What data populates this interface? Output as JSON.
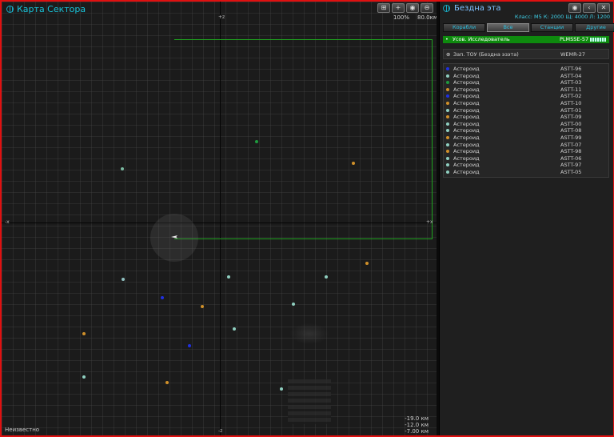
{
  "map": {
    "title": "Карта Сектора",
    "zoom": "100%",
    "range": "80.0км",
    "axis_top": "+z",
    "axis_bottom": "-z",
    "axis_left": "-x",
    "axis_right": "+x",
    "status": "Неизвестно",
    "distances": [
      "-19.0 км",
      "-12.0 км",
      "-7.00 км"
    ],
    "toolbar": [
      "⊞",
      "+",
      "◉",
      "⊖"
    ],
    "objects": [
      {
        "color": "#7ab8a0"
      },
      {
        "color": "#1e9a3e"
      },
      {
        "color": "#d0902a"
      },
      {
        "color": "#8fbfbf"
      },
      {
        "color": "#8fcfc0"
      },
      {
        "color": "#8fcfc0"
      },
      {
        "color": "#d0902a"
      },
      {
        "color": "#2030e0"
      },
      {
        "color": "#d0902a"
      },
      {
        "color": "#8fcfc0"
      },
      {
        "color": "#8fcfc0"
      },
      {
        "color": "#d0902a"
      },
      {
        "color": "#2030e0"
      },
      {
        "color": "#8fcfc0"
      },
      {
        "color": "#d0902a"
      },
      {
        "color": "#8fcfc0"
      }
    ]
  },
  "side": {
    "title": "Бездна эта",
    "class_line": "Класс: M5  К: 2000  Щ: 4000  Л: 1200",
    "toolbar": [
      "◉",
      "‹",
      "✕"
    ],
    "tabs": [
      "Корабли",
      "Все",
      "Станции",
      "Другие"
    ],
    "selected": {
      "name": "Усов. Исследователь",
      "code": "PLMSSE-57"
    },
    "tow": {
      "name": "Зап. ТОУ (Бездна эзэта)",
      "code": "WEMR-27"
    },
    "asteroids": [
      {
        "name": "Астероид",
        "code": "ASTT-96",
        "color": "#2030e0"
      },
      {
        "name": "Астероид",
        "code": "ASTT-04",
        "color": "#8fcfc0"
      },
      {
        "name": "Астероид",
        "code": "ASTT-03",
        "color": "#1e9a3e"
      },
      {
        "name": "Астероид",
        "code": "ASTT-11",
        "color": "#d0902a"
      },
      {
        "name": "Астероид",
        "code": "ASTT-02",
        "color": "#2030e0"
      },
      {
        "name": "Астероид",
        "code": "ASTT-10",
        "color": "#d0902a"
      },
      {
        "name": "Астероид",
        "code": "ASTT-01",
        "color": "#8fcfc0"
      },
      {
        "name": "Астероид",
        "code": "ASTT-09",
        "color": "#d0902a"
      },
      {
        "name": "Астероид",
        "code": "ASTT-00",
        "color": "#8fcfc0"
      },
      {
        "name": "Астероид",
        "code": "ASTT-08",
        "color": "#8fcfc0"
      },
      {
        "name": "Астероид",
        "code": "ASTT-99",
        "color": "#d0902a"
      },
      {
        "name": "Астероид",
        "code": "ASTT-07",
        "color": "#8fcfc0"
      },
      {
        "name": "Астероид",
        "code": "ASTT-98",
        "color": "#d0902a"
      },
      {
        "name": "Астероид",
        "code": "ASTT-06",
        "color": "#8fcfc0"
      },
      {
        "name": "Астероид",
        "code": "ASTT-97",
        "color": "#8fcfc0"
      },
      {
        "name": "Астероид",
        "code": "ASTT-05",
        "color": "#8fcfc0"
      }
    ]
  }
}
